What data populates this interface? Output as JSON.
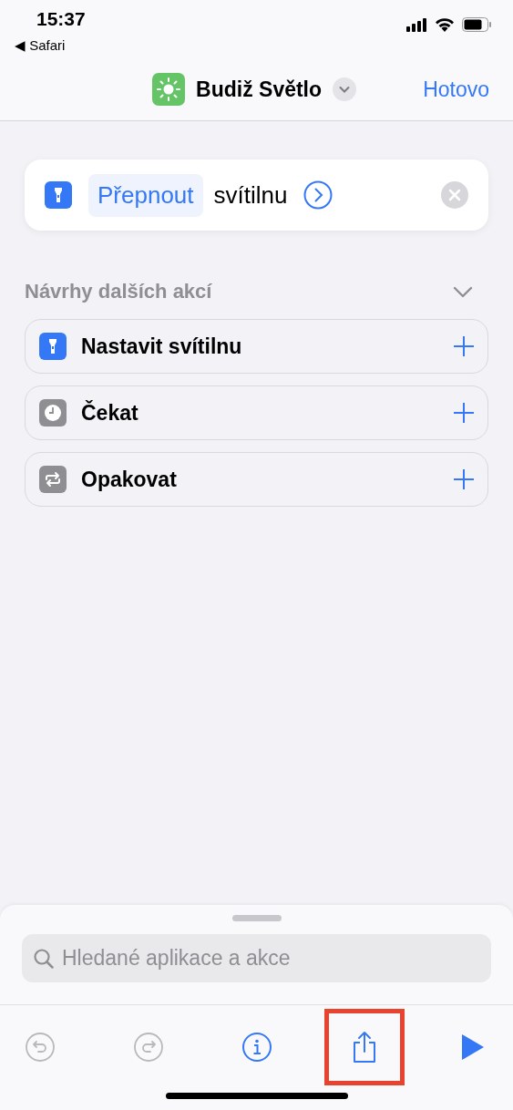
{
  "status_bar": {
    "time": "15:37",
    "back_app": "◀ Safari"
  },
  "nav": {
    "title": "Budiž Světlo",
    "done": "Hotovo"
  },
  "action": {
    "verb": "Přepnout",
    "object": "svítilnu"
  },
  "suggestions": {
    "title": "Návrhy dalších akcí",
    "expanded": true,
    "items": [
      {
        "kind": "flashlight",
        "label": "Nastavit svítilnu",
        "color": "#3478f6"
      },
      {
        "kind": "clock",
        "label": "Čekat",
        "color": "#8e8e93"
      },
      {
        "kind": "repeat",
        "label": "Opakovat",
        "color": "#8e8e93"
      }
    ]
  },
  "search": {
    "placeholder": "Hledané aplikace a akce"
  },
  "toolbar": [
    {
      "kind": "undo",
      "disabled": true,
      "highlighted": false
    },
    {
      "kind": "redo",
      "disabled": true,
      "highlighted": false
    },
    {
      "kind": "info",
      "disabled": false,
      "highlighted": false
    },
    {
      "kind": "share",
      "disabled": false,
      "highlighted": true
    },
    {
      "kind": "play",
      "disabled": false,
      "highlighted": false
    }
  ]
}
